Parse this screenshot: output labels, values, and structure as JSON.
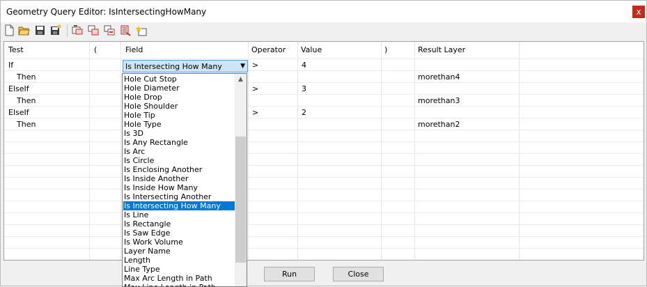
{
  "window": {
    "title": "Geometry Query Editor: IsIntersectingHowMany",
    "close_glyph": "x"
  },
  "toolbar": {
    "icons": [
      "new-icon",
      "open-icon",
      "save-icon",
      "save-as-icon",
      "insert-row-icon",
      "insert-row-after-icon",
      "delete-row-icon",
      "delete-rows-icon",
      "run-query-icon"
    ]
  },
  "grid": {
    "headers": {
      "test": "Test",
      "open_paren": "(",
      "field": "Field",
      "operator": "Operator",
      "value": "Value",
      "close_paren": ")",
      "result_layer": "Result Layer"
    },
    "rows": [
      {
        "test": "If",
        "field": "Is Intersecting How Many",
        "operator": ">",
        "value": "4",
        "result": ""
      },
      {
        "test": "Then",
        "field": "",
        "operator": "",
        "value": "",
        "result": "morethan4"
      },
      {
        "test": "ElseIf",
        "field": "",
        "operator": ">",
        "value": "3",
        "result": ""
      },
      {
        "test": "Then",
        "field": "",
        "operator": "",
        "value": "",
        "result": "morethan3"
      },
      {
        "test": "ElseIf",
        "field": "",
        "operator": ">",
        "value": "2",
        "result": ""
      },
      {
        "test": "Then",
        "field": "",
        "operator": "",
        "value": "",
        "result": "morethan2"
      }
    ]
  },
  "field_dropdown": {
    "selected": "Is Intersecting How Many",
    "options": [
      "Hole Cut Stop",
      "Hole Diameter",
      "Hole Drop",
      "Hole Shoulder",
      "Hole Tip",
      "Hole Type",
      "Is 3D",
      "Is Any Rectangle",
      "Is Arc",
      "Is Circle",
      "Is Enclosing Another",
      "Is Inside Another",
      "Is Inside How Many",
      "Is Intersecting Another",
      "Is Intersecting How Many",
      "Is Line",
      "Is Rectangle",
      "Is Saw Edge",
      "Is Work Volume",
      "Layer Name",
      "Length",
      "Line Type",
      "Max Arc Length in Path",
      "Max Line Length in Path"
    ]
  },
  "buttons": {
    "run": "Run",
    "close": "Close"
  },
  "colors": {
    "selection": "#0078d7",
    "combo_bg": "#cde6f7",
    "close_bg": "#c42b1c"
  }
}
